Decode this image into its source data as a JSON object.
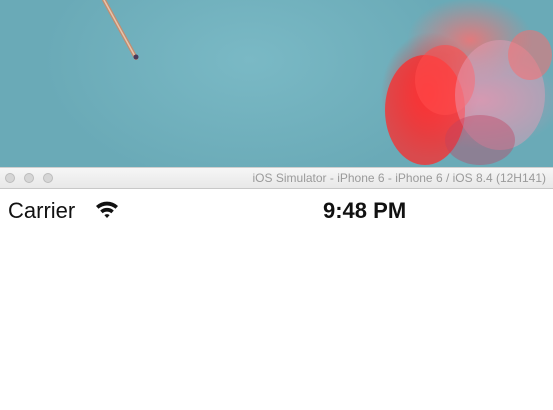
{
  "window": {
    "title": "iOS Simulator - iPhone 6 - iPhone 6 / iOS 8.4 (12H141)"
  },
  "status_bar": {
    "carrier": "Carrier",
    "time": "9:48 PM",
    "wifi_icon": "wifi-icon"
  },
  "colors": {
    "wallpaper": "#6fb0bd",
    "titlebar": "#eeeeee",
    "screen_background": "#ffffff"
  }
}
